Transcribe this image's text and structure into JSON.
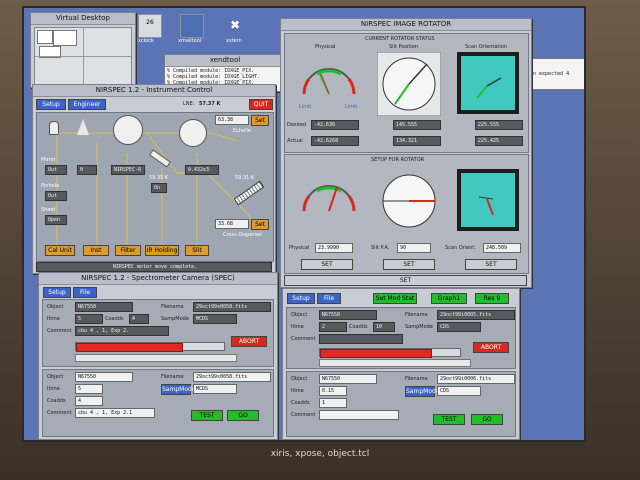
{
  "desktop": {
    "virtual_desktop_title": "Virtual Desktop",
    "icons": [
      {
        "label": "xclock",
        "name": "clock-icon"
      },
      {
        "label": "xmailtool",
        "name": "mail-icon"
      },
      {
        "label": "xstern",
        "name": "xstern-icon"
      }
    ],
    "clock_day": "26",
    "xterm_title": "xendtool",
    "console_lines": [
      "% Compiled module: IDXGE_PIX.",
      "% Compiled module: IDXGE_LIGHT.",
      "% Compiled module: IDXGE_PIX."
    ],
    "console_right_text": "on expected 4"
  },
  "instrument_control": {
    "title": "NIRSPEC 1.2 - Instrument Control",
    "setup_label": "Setup",
    "engineer_label": "Engineer",
    "lne_label": "LNE:",
    "lne_value": "57.37 K",
    "quit_label": "QUIT",
    "echelle_angle": "63.38",
    "echelle_set": "Set",
    "echelle_label": "Echelle",
    "filter_label": "NIRSPEC-6",
    "wavelength": "0.432e3",
    "temp1": "59.35 K",
    "temp2": "59.31 K",
    "on_label": "On",
    "xdisp_angle": "33.68",
    "xdisp_set": "Set",
    "cross_disperser_label": "Cross Disperser",
    "mirror_label": "Mirror",
    "mirror_value": "Out",
    "pinhole_label": "Pinhole",
    "pinhole_value": "Out",
    "sheet_label": "Sheet",
    "sheet_value": "Open",
    "val_n1": "0",
    "bottom_buttons": [
      "Cal Unit",
      "Inst",
      "Filter",
      "IR Holding",
      "Slit"
    ],
    "status": "NIRSPEC motor move complete."
  },
  "rotator": {
    "title": "NIRSPEC IMAGE ROTATOR",
    "current_status_label": "CURRENT ROTATOR STATUS",
    "setup_label": "SETUP FOR ROTATOR",
    "gauge_labels": [
      "Physical",
      "Slit Position",
      "Scan Orientation"
    ],
    "desired_label": "Desired",
    "actual_label": "Actual",
    "desired_values": [
      "-42.636",
      "145.555",
      "225.555"
    ],
    "actual_values": [
      "-42.6268",
      "134.321",
      "225.425"
    ],
    "limit_left": "Limit",
    "limit_right": "Limit",
    "setup_fields": [
      {
        "label": "Physical",
        "value": "23.9990"
      },
      {
        "label": "Slit P.A.",
        "value": "90"
      },
      {
        "label": "Scan Orient.",
        "value": "248.509"
      }
    ],
    "set_label": "SET",
    "bottom_set": "SET"
  },
  "spec_camera": {
    "title": "NIRSPEC 1.2 - Spectrometer Camera (SPEC)",
    "setup_label": "Setup",
    "file_label": "File",
    "object_label": "Object",
    "object_value": "N67550",
    "itime_label": "Itime",
    "itime_value": "5",
    "coadds_label": "Coadds",
    "coadds_value": "4",
    "comment_label": "Comment",
    "comment_value": "cbu 4 , 1, Exp 2.",
    "filename_label": "Filename",
    "filename_value": "29oct99s0058.fits",
    "sampmode_label": "SampMode",
    "sampmode_value": "MCDS",
    "abort_label": "ABORT",
    "progress": 0.72,
    "object2_value": "N67550",
    "itime2_value": "5",
    "coadds2_value": "4",
    "comment2_value": "cbu 4 , 1, Exp 2.1",
    "filename2_value": "29oct99s0058.fits",
    "sampmode2_value": "MCDS",
    "test_label": "TEST",
    "go_label": "GO"
  },
  "right_camera": {
    "setup_label": "Setup",
    "file_label": "File",
    "green_buttons": [
      "Set Mod Stat",
      "Graph1",
      "Res 9"
    ],
    "object_value": "N67550",
    "itime_value": "2",
    "coadds_value": "10",
    "filename_value": "29oct99i0005.fits",
    "sampmode_value": "CDS",
    "abort_label": "ABORT",
    "progress": 0.8,
    "object2_value": "N67550",
    "itime2_value": "0.15",
    "coadds2_value": "1",
    "filename2_value": "29oct99i0006.fits",
    "sampmode2_value": "CDS",
    "test_label": "TEST",
    "go_label": "GO",
    "object_label": "Object",
    "itime_label": "Itime",
    "coadds_label": "Coadds",
    "comment_label": "Comment",
    "filename_label": "Filename",
    "sampmode_label": "SampMode"
  },
  "caption": "xiris, xpose, object.tcl"
}
